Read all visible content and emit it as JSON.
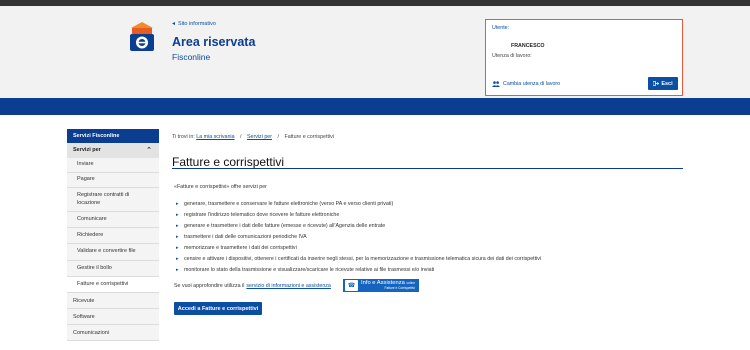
{
  "header": {
    "site_link": "Sito informativo",
    "title": "Area riservata",
    "subtitle": "Fisconline"
  },
  "user_box": {
    "user_label": "Utente:",
    "user_name": "FRANCESCO",
    "utenza_label": "Utenza di lavoro:",
    "change_label": "Cambia utenza di lavoro",
    "exit_label": "Esci"
  },
  "sidebar": {
    "header": "Servizi Fisconline",
    "group": "Servizi per",
    "items": [
      {
        "label": "Inviare"
      },
      {
        "label": "Pagare"
      },
      {
        "label": "Registrare contratti di locazione"
      },
      {
        "label": "Comunicare"
      },
      {
        "label": "Richiedere"
      },
      {
        "label": "Validare e convertire file"
      },
      {
        "label": "Gestire il bollo"
      },
      {
        "label": "Fatture e corrispettivi"
      }
    ],
    "sections": [
      {
        "label": "Ricevute"
      },
      {
        "label": "Software"
      },
      {
        "label": "Comunicazioni"
      }
    ]
  },
  "breadcrumb": {
    "prefix": "Ti trovi in:",
    "items": [
      "La mia scrivania",
      "Servizi per"
    ],
    "current": "Fatture e corrispettivi",
    "separator": "/"
  },
  "main": {
    "title": "Fatture e corrispettivi",
    "intro": "«Fatture e corrispettivi» offre servizi per",
    "services": [
      "generare, trasmettere e conservare le fatture elettroniche (verso PA e verso clienti privati)",
      "registrare l'indirizzo telematico dove ricevere le fatture elettroniche",
      "generare e trasmettere i dati delle fatture (emesse e ricevute) all'Agenzia delle entrate",
      "trasmettere i dati delle comunicazioni periodiche IVA",
      "memorizzare e trasmettere i dati dei corrispettivi",
      "censire e attivare i dispositivi, ottenere i certificati da inserire negli stessi, per la memorizzazione e trasmissione telematica sicura dei dati dei corrispettivi",
      "monitorare lo stato della trasmissione e visualizzare/scaricare le ricevute relative ai file trasmessi e/o inviati"
    ],
    "more_text": "Se vuoi approfondire utilizza il",
    "more_link": "servizio di informazioni e assistenza",
    "badge_title": "Info e Assistenza",
    "badge_online": "online",
    "badge_sub": "Fatture e Corrispettivi",
    "cta": "Accedi a Fatture e corrispettivi"
  },
  "colors": {
    "primary": "#0b3d91",
    "link": "#0b4ea2",
    "user_box_border": "#e8583a"
  }
}
